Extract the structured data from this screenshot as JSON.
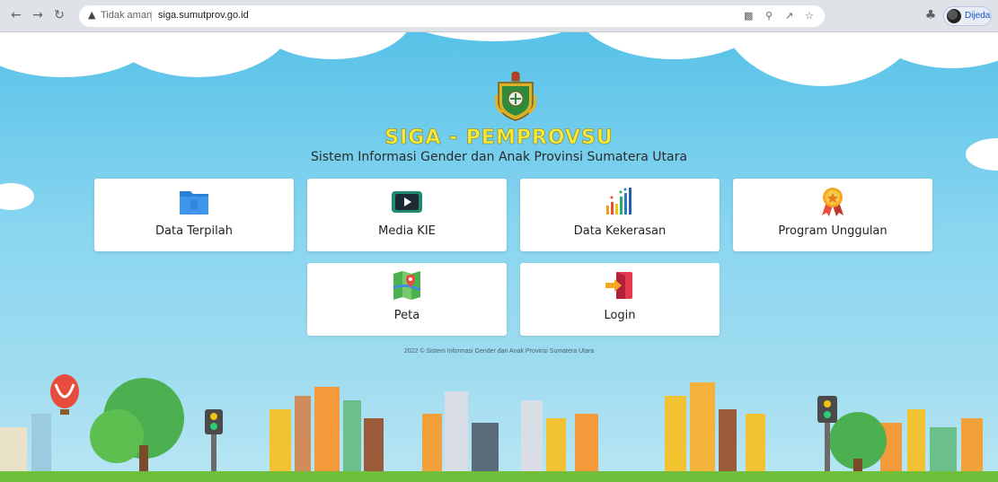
{
  "browser": {
    "back_icon": "back-arrow-icon",
    "forward_icon": "forward-arrow-icon",
    "reload_icon": "reload-icon",
    "security_label": "Tidak aman",
    "url": "siga.sumutprov.go.id",
    "profile_label": "Dijeda"
  },
  "header": {
    "title": "SIGA - PEMPROVSU",
    "subtitle": "Sistem Informasi Gender dan Anak Provinsi Sumatera Utara"
  },
  "menu": {
    "data_terpilah": "Data Terpilah",
    "media_kie": "Media KIE",
    "data_kekerasan": "Data Kekerasan",
    "program_unggulan": "Program Unggulan",
    "peta": "Peta",
    "login": "Login"
  },
  "footer": {
    "copyright": "2022 © Sistem Informasi Gender dan Anak Provinsi Sumatera Utara"
  },
  "colors": {
    "sky": "#7fd0ec",
    "title_yellow": "#f8e93a",
    "card_bg": "#ffffff"
  }
}
